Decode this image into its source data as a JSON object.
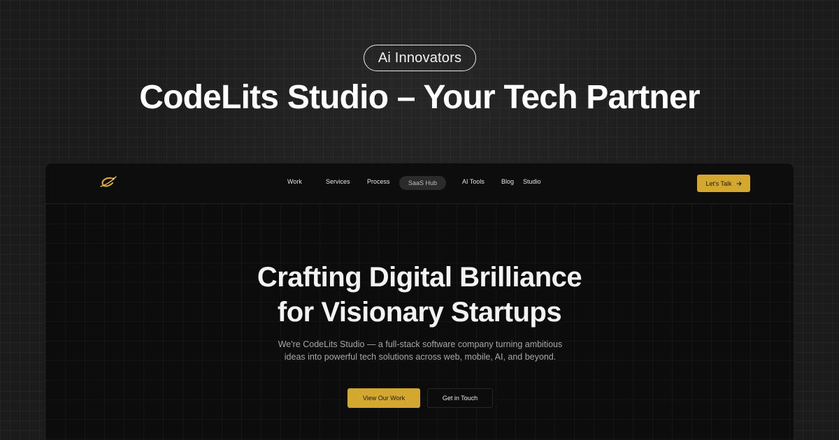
{
  "banner": {
    "badge": "Ai Innovators",
    "headline": "CodeLits Studio – Your Tech Partner"
  },
  "nav": {
    "logo_icon": "codelits-swoosh-logo",
    "items": [
      {
        "label": "Work"
      },
      {
        "label": "Services"
      },
      {
        "label": "Process"
      },
      {
        "label": "SaaS Hub"
      },
      {
        "label": "AI Tools"
      },
      {
        "label": "Blog"
      },
      {
        "label": "Studio"
      }
    ],
    "cta_label": "Let's Talk",
    "cta_icon": "arrow-right-icon"
  },
  "hero": {
    "title_line1": "Crafting Digital Brilliance",
    "title_line2": "for Visionary Startups",
    "subtitle": "We're CodeLits Studio — a full-stack software company turning ambitious ideas into powerful tech solutions across web, mobile, AI, and beyond.",
    "primary_button": "View Our Work",
    "secondary_button": "Get in Touch"
  },
  "colors": {
    "accent": "#d4a82e",
    "background": "#1b1b1b",
    "frame_background": "#0c0c0c"
  }
}
